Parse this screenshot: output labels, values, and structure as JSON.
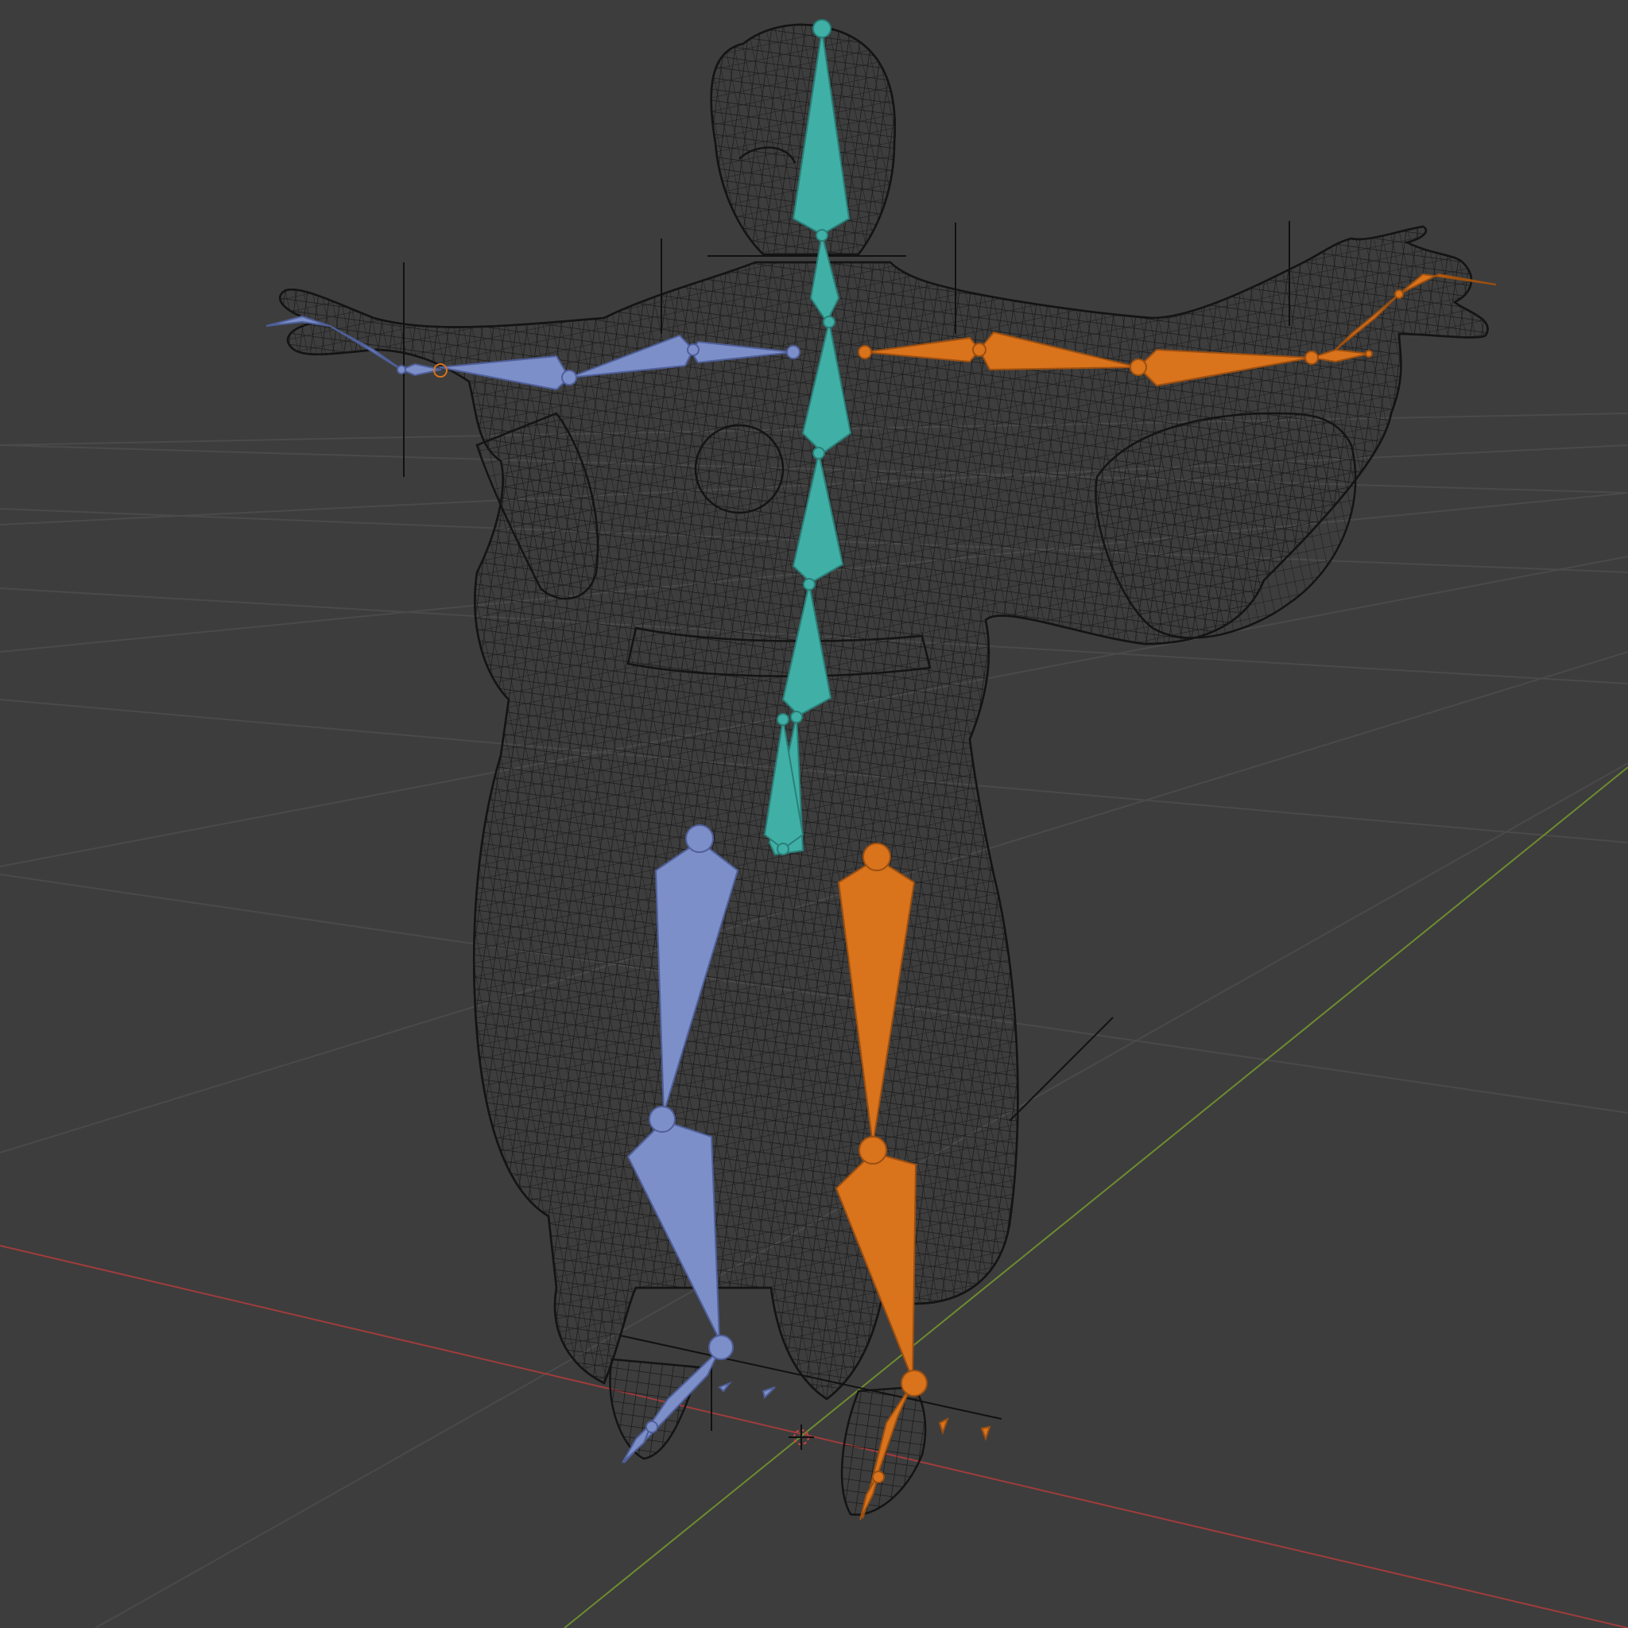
{
  "viewport": {
    "background": "#3d3d3d",
    "grid_color": "#4a4a4a",
    "x_axis_color": "#a03c3c",
    "y_axis_color": "#6e8c2e",
    "mesh_color": "#141414",
    "shading": "wireframe",
    "object": "armature-with-character-mesh"
  },
  "armature": {
    "center_color": "#40b0a6",
    "left_side_color": "#7d8fc8",
    "right_side_color": "#d9731c",
    "center_bones": [
      "head",
      "neck",
      "spine-upper",
      "spine-mid",
      "spine-lower",
      "pelvis",
      "hips"
    ],
    "left_bones": [
      "upper-arm",
      "forearm",
      "hand",
      "fingers",
      "thigh",
      "shin",
      "foot"
    ],
    "right_bones": [
      "upper-arm",
      "forearm",
      "hand",
      "fingers",
      "thigh",
      "shin",
      "foot"
    ]
  }
}
